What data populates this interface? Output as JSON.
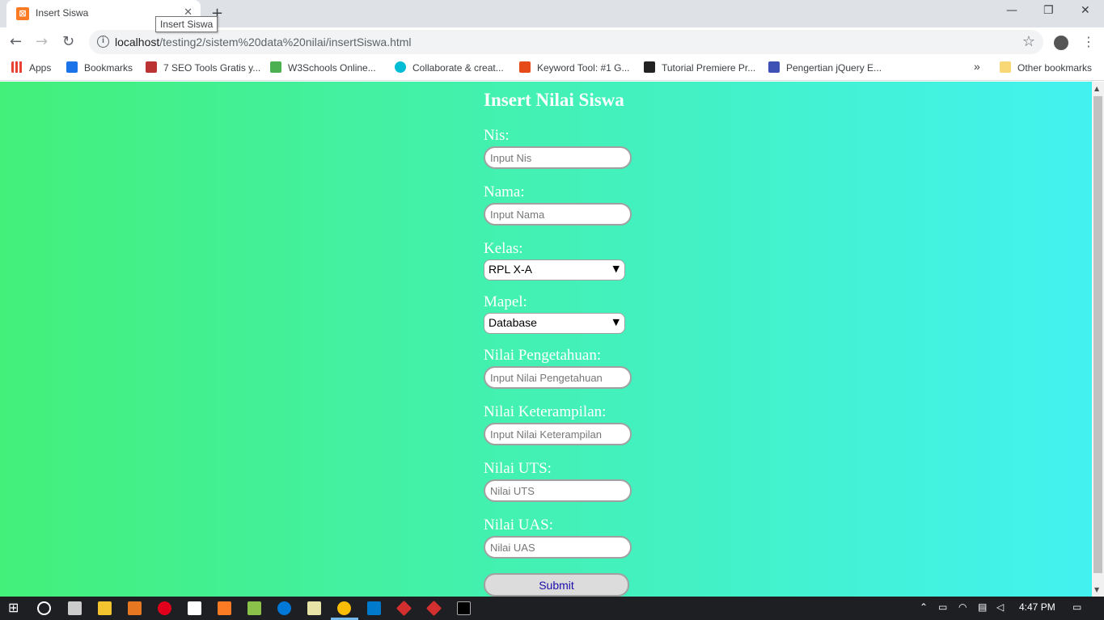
{
  "browser": {
    "tab_title": "Insert Siswa",
    "tooltip": "Insert Siswa",
    "url_host": "localhost",
    "url_path": "/testing2/sistem%20data%20nilai/insertSiswa.html",
    "bookmarks": [
      {
        "label": "Apps",
        "color": "#e94235"
      },
      {
        "label": "Bookmarks",
        "color": "#1a73e8"
      },
      {
        "label": "7 SEO Tools Gratis y...",
        "color": "#b33"
      },
      {
        "label": "W3Schools Online...",
        "color": "#4caf50"
      },
      {
        "label": "Collaborate & creat...",
        "color": "#00bcd4"
      },
      {
        "label": "Keyword Tool: #1 G...",
        "color": "#e64a19"
      },
      {
        "label": "Tutorial Premiere Pr...",
        "color": "#222"
      },
      {
        "label": "Pengertian jQuery E...",
        "color": "#3f51b5"
      }
    ],
    "bookmarks_overflow": "»",
    "other_bookmarks": "Other bookmarks"
  },
  "form": {
    "title": "Insert Nilai Siswa",
    "nis_label": "Nis:",
    "nis_placeholder": "Input Nis",
    "nama_label": "Nama:",
    "nama_placeholder": "Input Nama",
    "kelas_label": "Kelas:",
    "kelas_value": "RPL X-A",
    "mapel_label": "Mapel:",
    "mapel_value": "Database",
    "pengetahuan_label": "Nilai Pengetahuan:",
    "pengetahuan_placeholder": "Input Nilai Pengetahuan",
    "keterampilan_label": "Nilai Keterampilan:",
    "keterampilan_placeholder": "Input Nilai Keterampilan",
    "uts_label": "Nilai UTS:",
    "uts_placeholder": "Nilai UTS",
    "uas_label": "Nilai UAS:",
    "uas_placeholder": "Nilai UAS",
    "submit_label": "Submit"
  },
  "taskbar": {
    "time": "4:47 PM"
  },
  "colors": {
    "gradient_start": "#43f07a",
    "gradient_end": "#43f2f0",
    "submit_text": "#1a0dab"
  }
}
